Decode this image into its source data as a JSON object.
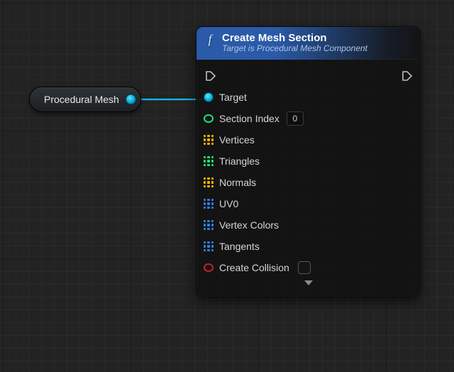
{
  "variable_node": {
    "label": "Procedural Mesh",
    "output_pin_type": "object"
  },
  "function_node": {
    "icon": "f",
    "title": "Create Mesh Section",
    "subtitle": "Target is Procedural Mesh Component",
    "pins": {
      "target": {
        "label": "Target",
        "pin": "object-filled",
        "color": "#17b8e8"
      },
      "section_index": {
        "label": "Section Index",
        "pin": "ring",
        "color": "#1ee27a",
        "value": "0"
      },
      "vertices": {
        "label": "Vertices",
        "pin": "array",
        "color": "#f2b300"
      },
      "triangles": {
        "label": "Triangles",
        "pin": "array",
        "color": "#1ee27a"
      },
      "normals": {
        "label": "Normals",
        "pin": "array",
        "color": "#f2b300"
      },
      "uv0": {
        "label": "UV0",
        "pin": "array",
        "color": "#2f7de0"
      },
      "vertex_colors": {
        "label": "Vertex Colors",
        "pin": "array",
        "color": "#2f7de0"
      },
      "tangents": {
        "label": "Tangents",
        "pin": "array",
        "color": "#2f7de0"
      },
      "create_collision": {
        "label": "Create Collision",
        "pin": "ring",
        "color": "#c4222f",
        "checked": false
      }
    }
  }
}
